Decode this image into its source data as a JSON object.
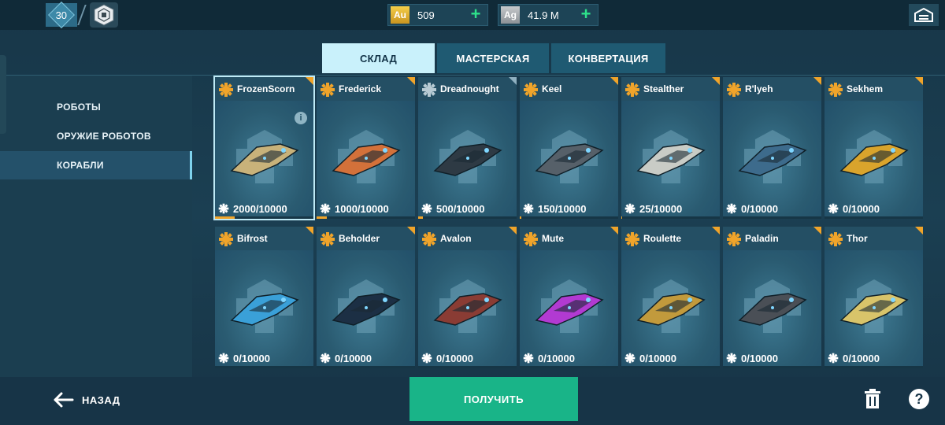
{
  "top_bar": {
    "level": "30",
    "currencies": [
      {
        "code": "Au",
        "amount": "509",
        "color": "#f0c23a"
      },
      {
        "code": "Ag",
        "amount": "41.9 M",
        "color": "#b5b9bd"
      }
    ]
  },
  "tabs": [
    {
      "label": "СКЛАД",
      "active": true
    },
    {
      "label": "МАСТЕРСКАЯ",
      "active": false
    },
    {
      "label": "КОНВЕРТАЦИЯ",
      "active": false
    }
  ],
  "categories": [
    {
      "label": "РОБОТЫ",
      "active": false
    },
    {
      "label": "ОРУЖИЕ РОБОТОВ",
      "active": false
    },
    {
      "label": "КОРАБЛИ",
      "active": true
    }
  ],
  "ships": [
    {
      "name": "FrozenScorn",
      "count": "2000/10000",
      "progress": 0.2,
      "tier": "gold",
      "selected": true,
      "ship_color": "#c8b27a"
    },
    {
      "name": "Frederick",
      "count": "1000/10000",
      "progress": 0.1,
      "tier": "gold",
      "ship_color": "#d3713a"
    },
    {
      "name": "Dreadnought",
      "count": "500/10000",
      "progress": 0.05,
      "tier": "grey",
      "ship_color": "#2e3a44"
    },
    {
      "name": "Keel",
      "count": "150/10000",
      "progress": 0.015,
      "tier": "gold",
      "ship_color": "#566069"
    },
    {
      "name": "Stealther",
      "count": "25/10000",
      "progress": 0.0025,
      "tier": "gold",
      "ship_color": "#c9ccc6"
    },
    {
      "name": "R'lyeh",
      "count": "0/10000",
      "progress": 0,
      "tier": "gold",
      "ship_color": "#3d6b8c"
    },
    {
      "name": "Sekhem",
      "count": "0/10000",
      "progress": 0,
      "tier": "gold",
      "ship_color": "#d9a42c"
    },
    {
      "name": "Bifrost",
      "count": "0/10000",
      "progress": 0,
      "tier": "gold",
      "ship_color": "#3aa0d8"
    },
    {
      "name": "Beholder",
      "count": "0/10000",
      "progress": 0,
      "tier": "gold",
      "ship_color": "#1c2f44"
    },
    {
      "name": "Avalon",
      "count": "0/10000",
      "progress": 0,
      "tier": "gold",
      "ship_color": "#8a3c34"
    },
    {
      "name": "Mute",
      "count": "0/10000",
      "progress": 0,
      "tier": "gold",
      "ship_color": "#b23ad2"
    },
    {
      "name": "Roulette",
      "count": "0/10000",
      "progress": 0,
      "tier": "gold",
      "ship_color": "#c29a3c"
    },
    {
      "name": "Paladin",
      "count": "0/10000",
      "progress": 0,
      "tier": "gold",
      "ship_color": "#4a4f56"
    },
    {
      "name": "Thor",
      "count": "0/10000",
      "progress": 0,
      "tier": "gold",
      "ship_color": "#d8c46a"
    }
  ],
  "bottom": {
    "back_label": "НАЗАД",
    "get_label": "ПОЛУЧИТЬ"
  },
  "colors": {
    "accent_orange": "#f0a42a",
    "primary_green": "#19b488",
    "tab_active": "#c9f1fb"
  },
  "icons": {
    "hangar": "hangar-icon",
    "back": "arrow-left-icon",
    "trash": "trash-icon",
    "help": "help-icon",
    "info": "info-icon",
    "component": "gear-token-icon"
  }
}
